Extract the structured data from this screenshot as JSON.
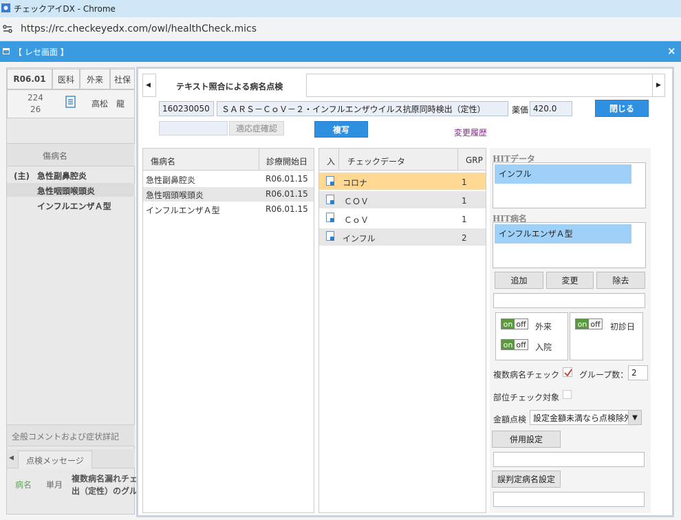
{
  "browser": {
    "window_title": "チェックアイDX - Chrome",
    "url": "https://rc.checkeyedx.com/owl/healthCheck.mics"
  },
  "modal": {
    "title": "【 レセ画面 】",
    "close": "×"
  },
  "left": {
    "header": [
      "R06.01",
      "医科",
      "外来",
      "社保"
    ],
    "patient_num1": "224",
    "patient_num2": "26",
    "patient_name": "高松　龍",
    "disease_header": "傷病名",
    "diseases": [
      {
        "prefix": "(主)",
        "name": "急性副鼻腔炎"
      },
      {
        "prefix": "",
        "name": "急性咽頭喉頭炎"
      },
      {
        "prefix": "",
        "name": "インフルエンザＡ型"
      }
    ],
    "comment_label": "全般コメントおよび症状詳記",
    "message_tab": "点検メッセージ",
    "msg_col1": "病名",
    "msg_col2": "単月",
    "msg_text_line1": "複数病名漏れチェ",
    "msg_text_line2": "出（定性）のグル"
  },
  "main": {
    "tab_label": "テキスト照合による病名点検",
    "code": "160230050",
    "item_name": "ＳＡＲＳ－ＣｏＶ－２・インフルエンザウイルス抗原同時検出（定性）",
    "price_label": "薬価",
    "price": "420.0",
    "close_btn": "閉じる",
    "indication_btn": "適応症確認",
    "copy_btn": "複写",
    "history_link": "変更履歴",
    "disease_table": {
      "headers": [
        "傷病名",
        "診療開始日"
      ],
      "rows": [
        {
          "name": "急性副鼻腔炎",
          "date": "R06.01.15"
        },
        {
          "name": "急性咽頭喉頭炎",
          "date": "R06.01.15"
        },
        {
          "name": "インフルエンザＡ型",
          "date": "R06.01.15"
        }
      ]
    },
    "check_table": {
      "headers": [
        "入",
        "チェックデータ",
        "GRP"
      ],
      "rows": [
        {
          "data": "コロナ",
          "grp": "1"
        },
        {
          "data": "ＣＯＶ",
          "grp": "1"
        },
        {
          "data": "ＣｏＶ",
          "grp": "1"
        },
        {
          "data": "インフル",
          "grp": "2"
        }
      ]
    },
    "hit_data_label": "HITデータ",
    "hit_data_value": "インフル",
    "hit_disease_label": "HIT病名",
    "hit_disease_value": "インフルエンザＡ型",
    "add_btn": "追加",
    "change_btn": "変更",
    "remove_btn": "除去",
    "toggle_on": "on",
    "toggle_off": "off",
    "outpatient": "外来",
    "inpatient": "入院",
    "first_visit": "初診日",
    "multi_check_label": "複数病名チェック",
    "group_count_label": "グループ数：",
    "group_count": "2",
    "part_check_label": "部位チェック対象",
    "amount_label": "金額点検",
    "amount_select": "設定金額未満なら点検除外",
    "combined_btn": "併用設定",
    "misjudge_btn": "誤判定病名設定"
  },
  "colors": {
    "accent": "#3a9be0",
    "button": "#2f8fe0",
    "highlight": "#ffd994",
    "selection": "#9fd0f8"
  }
}
